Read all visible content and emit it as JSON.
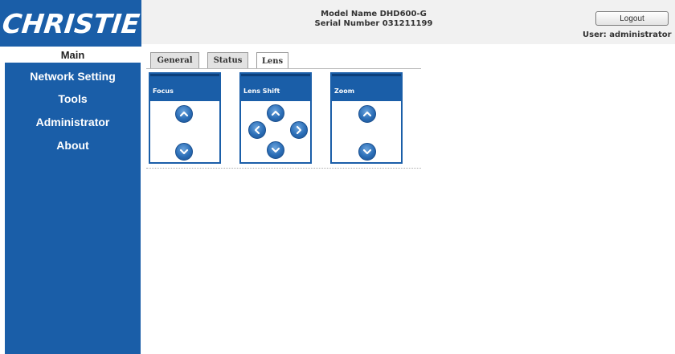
{
  "header": {
    "logo": "CHRISTIE",
    "model_name": "Model Name DHD600-G",
    "serial_number": "Serial Number 031211199",
    "logout_label": "Logout",
    "user_label": "User: administrator"
  },
  "sidebar": {
    "items": [
      {
        "label": "Main",
        "active": true
      },
      {
        "label": "Network Setting"
      },
      {
        "label": "Tools"
      },
      {
        "label": "Administrator"
      },
      {
        "label": "About"
      }
    ]
  },
  "tabs": [
    {
      "label": "General"
    },
    {
      "label": "Status"
    },
    {
      "label": "Lens",
      "active": true
    }
  ],
  "panels": {
    "focus": {
      "title": "Focus",
      "icons": [
        "arrow-up-icon",
        "arrow-down-icon"
      ]
    },
    "lens_shift": {
      "title": "Lens Shift",
      "icons": [
        "arrow-up-icon",
        "arrow-left-icon",
        "arrow-right-icon",
        "arrow-down-icon"
      ]
    },
    "zoom": {
      "title": "Zoom",
      "icons": [
        "arrow-up-icon",
        "arrow-down-icon"
      ]
    }
  },
  "colors": {
    "brand_blue": "#1a5ea8",
    "header_gray": "#f1f1f1"
  }
}
